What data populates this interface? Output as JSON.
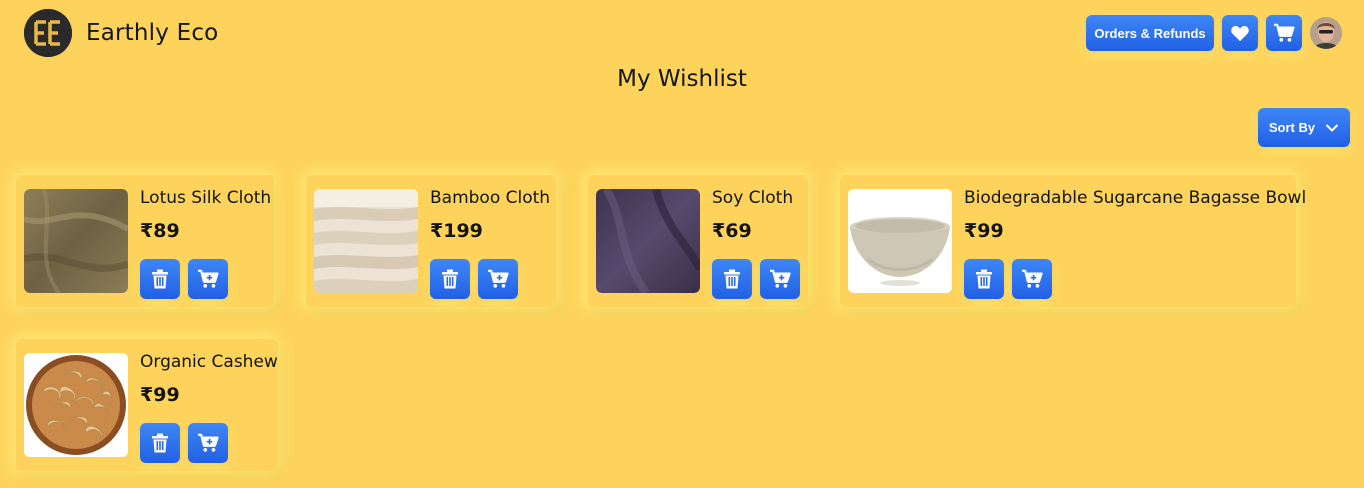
{
  "header": {
    "brand": "Earthly Eco",
    "orders_label": "Orders & Refunds",
    "icons": {
      "logo": "ee-logo",
      "wishlist": "heart-icon",
      "cart": "cart-icon",
      "avatar": "user-avatar"
    }
  },
  "page": {
    "title": "My Wishlist",
    "sort_label": "Sort By"
  },
  "wishlist": [
    {
      "name": "Lotus Silk Cloth",
      "price": "₹89",
      "image": "olive-fabric"
    },
    {
      "name": "Bamboo Cloth",
      "price": "₹199",
      "image": "cream-folded-fabric"
    },
    {
      "name": "Soy Cloth",
      "price": "₹69",
      "image": "purple-fabric"
    },
    {
      "name": "Biodegradable Sugarcane Bagasse Bowl",
      "price": "₹99",
      "image": "bagasse-bowl"
    },
    {
      "name": "Organic Cashew",
      "price": "₹99",
      "image": "cashew-bowl"
    }
  ],
  "colors": {
    "background": "#fdd35c",
    "accent": "#2f6ff0",
    "text": "#161616"
  }
}
